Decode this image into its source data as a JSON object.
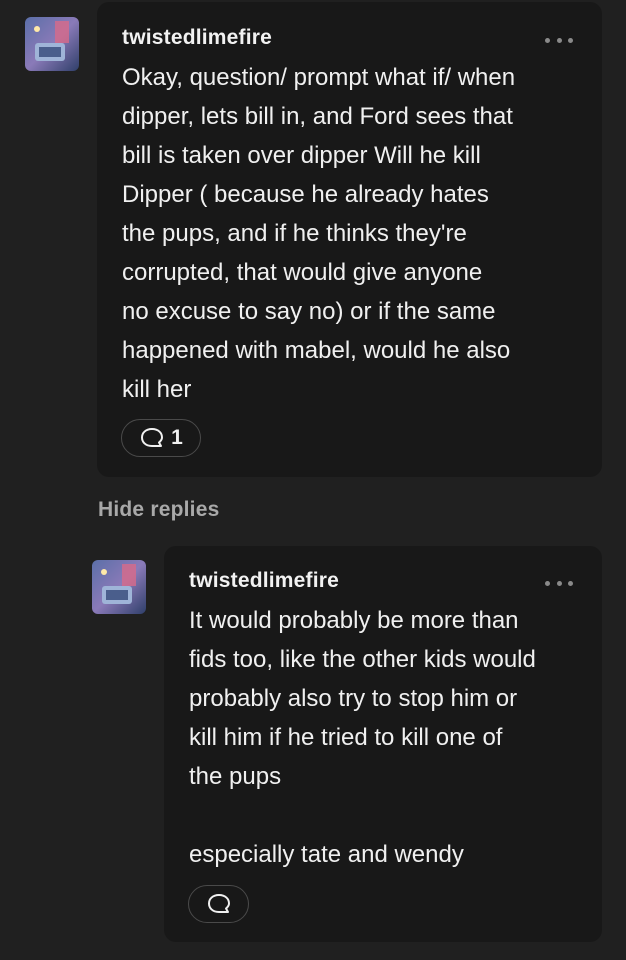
{
  "comments": [
    {
      "username": "twistedlimefire",
      "text": "Okay, question/ prompt what if/ when\ndipper, lets bill in, and Ford sees that\nbill is taken over dipper Will he kill\nDipper ( because he already hates\nthe pups, and if he thinks they're\ncorrupted, that would give anyone\nno excuse to say no) or if the same\nhappened with mabel, would he also\nkill her",
      "reply_count": "1"
    }
  ],
  "hide_replies_label": "Hide replies",
  "replies": [
    {
      "username": "twistedlimefire",
      "text": "It would probably be more than\nfids too, like the other kids would\nprobably also try to stop him or\nkill him if he tried to kill one of\nthe pups\n\nespecially tate and wendy"
    }
  ],
  "icons": {
    "reply": "speech-bubble-icon",
    "more": "more-dots-icon"
  }
}
